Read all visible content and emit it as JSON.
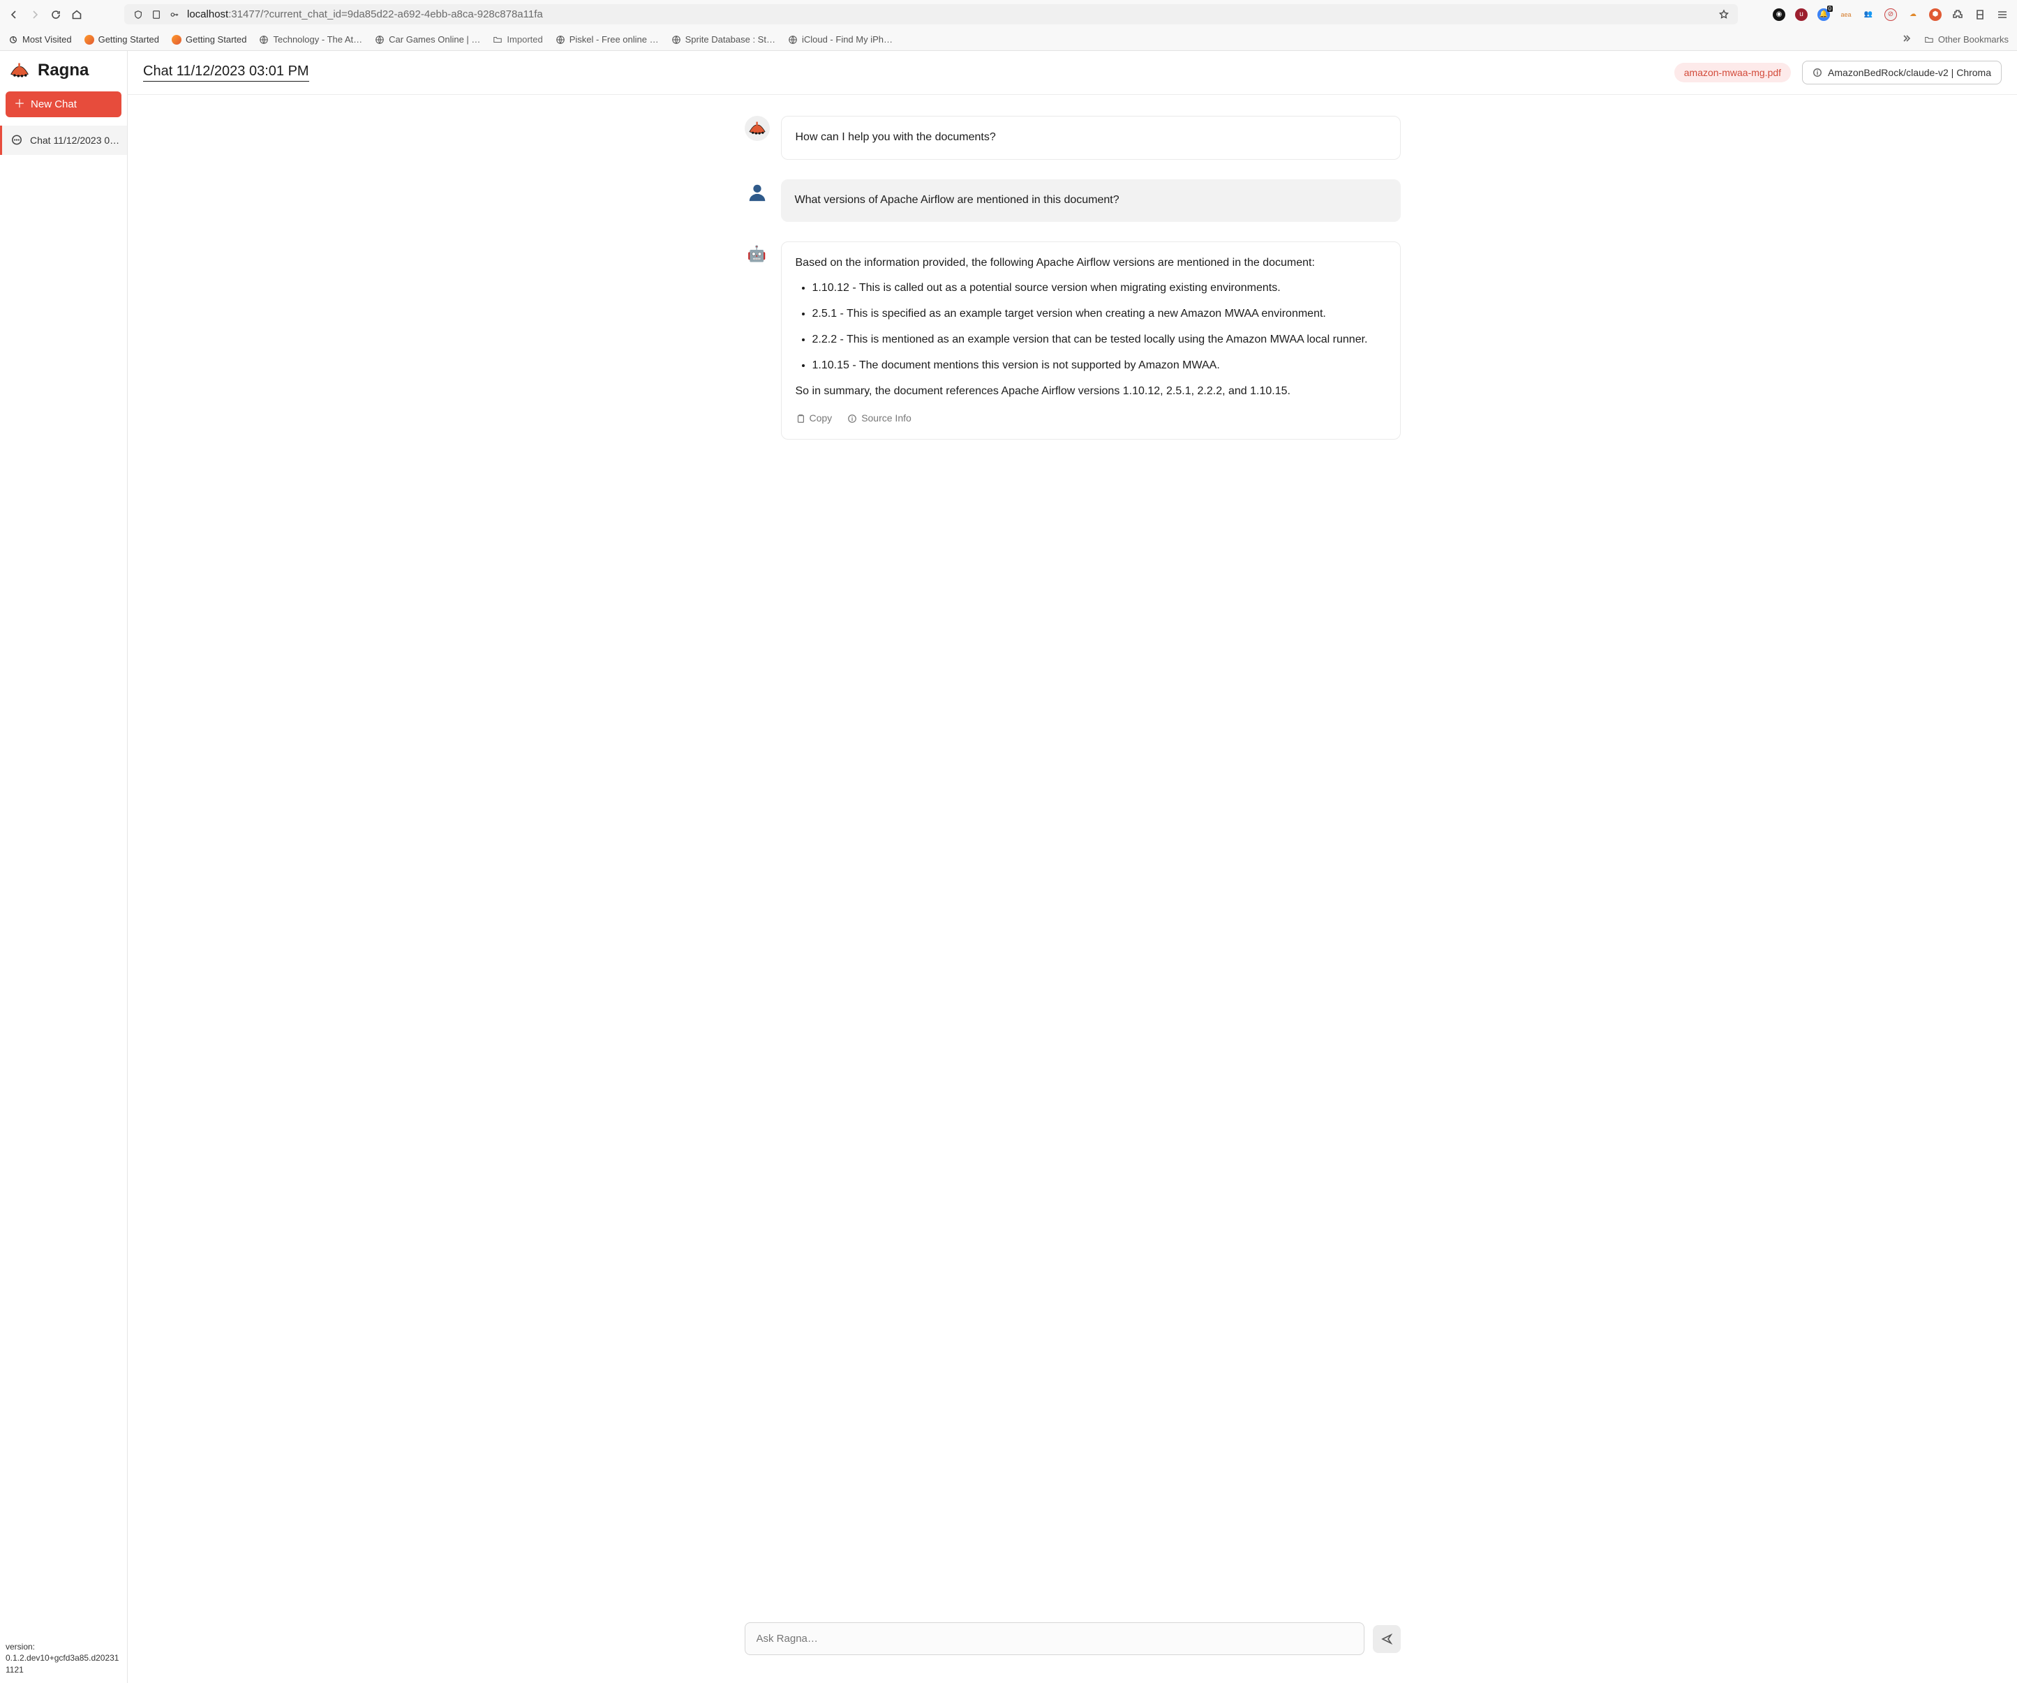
{
  "browser": {
    "url_host": "localhost",
    "url_rest": ":31477/?current_chat_id=9da85d22-a692-4ebb-a8ca-928c878a11fa",
    "bell_badge": "0",
    "aws_label": "aea",
    "other_bookmarks": "Other Bookmarks",
    "bookmarks": [
      "Most Visited",
      "Getting Started",
      "Getting Started",
      "Technology - The At…",
      "Car Games Online | …",
      "Imported",
      "Piskel - Free online …",
      "Sprite Database : St…",
      "iCloud - Find My iPh…"
    ]
  },
  "sidebar": {
    "brand": "Ragna",
    "new_chat": "New Chat",
    "chats": [
      {
        "label": "Chat 11/12/2023 0…"
      }
    ],
    "version_label": "version:",
    "version_value": "0.1.2.dev10+gcfd3a85.d202311121"
  },
  "header": {
    "title": "Chat 11/12/2023 03:01 PM",
    "doc_chip": "amazon-mwaa-mg.pdf",
    "model_chip": "AmazonBedRock/claude-v2 | Chroma"
  },
  "messages": {
    "system": "How can I help you with the documents?",
    "user": "What versions of Apache Airflow are mentioned in this document?",
    "bot_intro": "Based on the information provided, the following Apache Airflow versions are mentioned in the document:",
    "bot_bullets": [
      "1.10.12 - This is called out as a potential source version when migrating existing environments.",
      "2.5.1 - This is specified as an example target version when creating a new Amazon MWAA environment.",
      "2.2.2 - This is mentioned as an example version that can be tested locally using the Amazon MWAA local runner.",
      "1.10.15 - The document mentions this version is not supported by Amazon MWAA."
    ],
    "bot_summary": "So in summary, the document references Apache Airflow versions 1.10.12, 2.5.1, 2.2.2, and 1.10.15.",
    "copy": "Copy",
    "source_info": "Source Info"
  },
  "composer": {
    "placeholder": "Ask Ragna…"
  }
}
